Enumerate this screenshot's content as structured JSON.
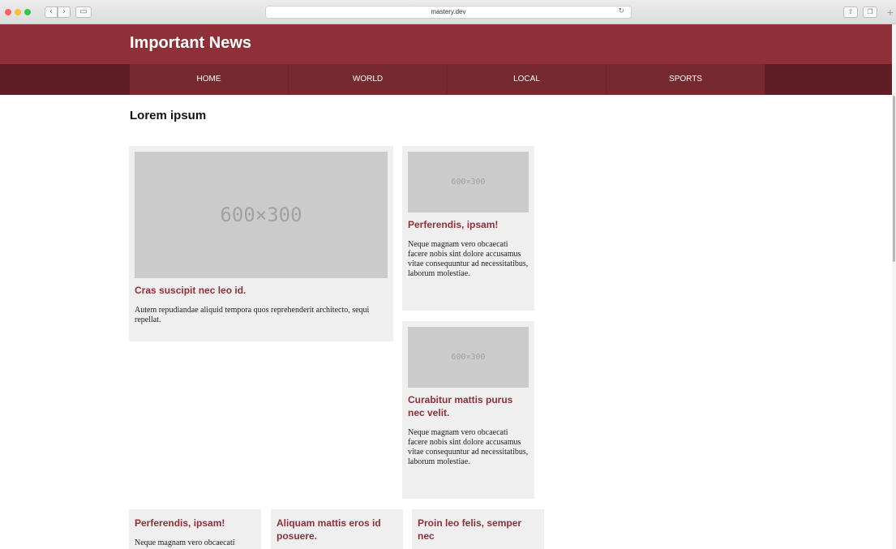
{
  "browser": {
    "url": "mastery.dev",
    "back_icon": "chevron-left-icon",
    "forward_icon": "chevron-right-icon",
    "sidebar_icon": "sidebar-icon",
    "reload_icon": "reload-icon",
    "share_icon": "share-icon",
    "tabs_icon": "tabs-icon",
    "new_tab_icon": "plus-icon"
  },
  "site": {
    "title": "Important News",
    "nav": [
      "HOME",
      "WORLD",
      "LOCAL",
      "SPORTS"
    ],
    "brand_color": "#8f3038",
    "nav_color": "#762a2f"
  },
  "main": {
    "heading": "Lorem ipsum",
    "cards": [
      {
        "image": "600×300",
        "title": "Cras suscipit nec leo id.",
        "body": "Autem repudiandae aliquid tempora quos reprehenderit architecto, sequi repellat."
      },
      {
        "image": "600×300",
        "title": "Perferendis, ipsam!",
        "body": "Neque magnam vero obcaecati facere nobis sint dolore accusamus vitae consequuntur ad necessitatibus, laborum molestiae."
      },
      {
        "image": "600×300",
        "title": "Curabitur mattis purus nec velit.",
        "body": "Neque magnam vero obcaecati facere nobis sint dolore accusamus vitae consequuntur ad necessitatibus, laborum molestiae."
      },
      {
        "title": "Perferendis, ipsam!",
        "body": "Neque magnam vero obcaecati"
      },
      {
        "title": "Aliquam mattis eros id posuere."
      },
      {
        "title": "Proin leo felis, semper nec"
      }
    ]
  }
}
